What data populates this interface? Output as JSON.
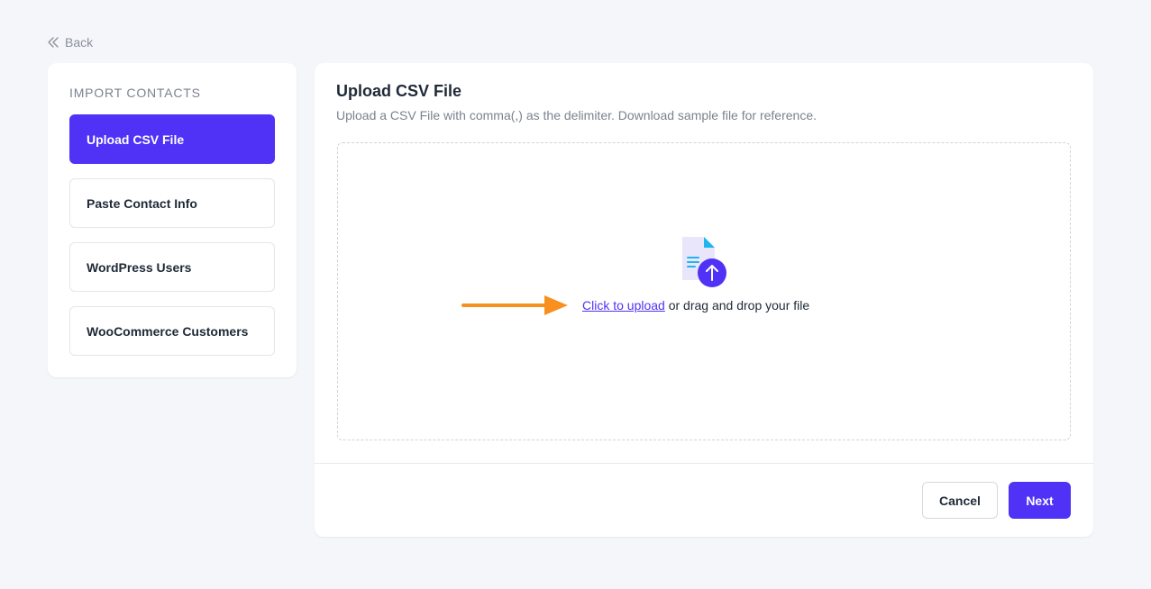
{
  "back": {
    "label": "Back"
  },
  "sidebar": {
    "title": "IMPORT CONTACTS",
    "items": [
      {
        "label": "Upload CSV File",
        "active": true
      },
      {
        "label": "Paste Contact Info",
        "active": false
      },
      {
        "label": "WordPress Users",
        "active": false
      },
      {
        "label": "WooCommerce Customers",
        "active": false
      }
    ]
  },
  "main": {
    "title": "Upload CSV File",
    "subtitle": "Upload a CSV File with comma(,) as the delimiter. Download sample file for reference.",
    "dropzone": {
      "link_text": "Click to upload",
      "rest_text": " or drag and drop your file"
    }
  },
  "footer": {
    "cancel_label": "Cancel",
    "next_label": "Next"
  },
  "colors": {
    "accent": "#4f32f5",
    "arrow": "#f7901e",
    "file_icon_bg": "#e9e6fb",
    "file_icon_corner": "#1fb6f0"
  }
}
